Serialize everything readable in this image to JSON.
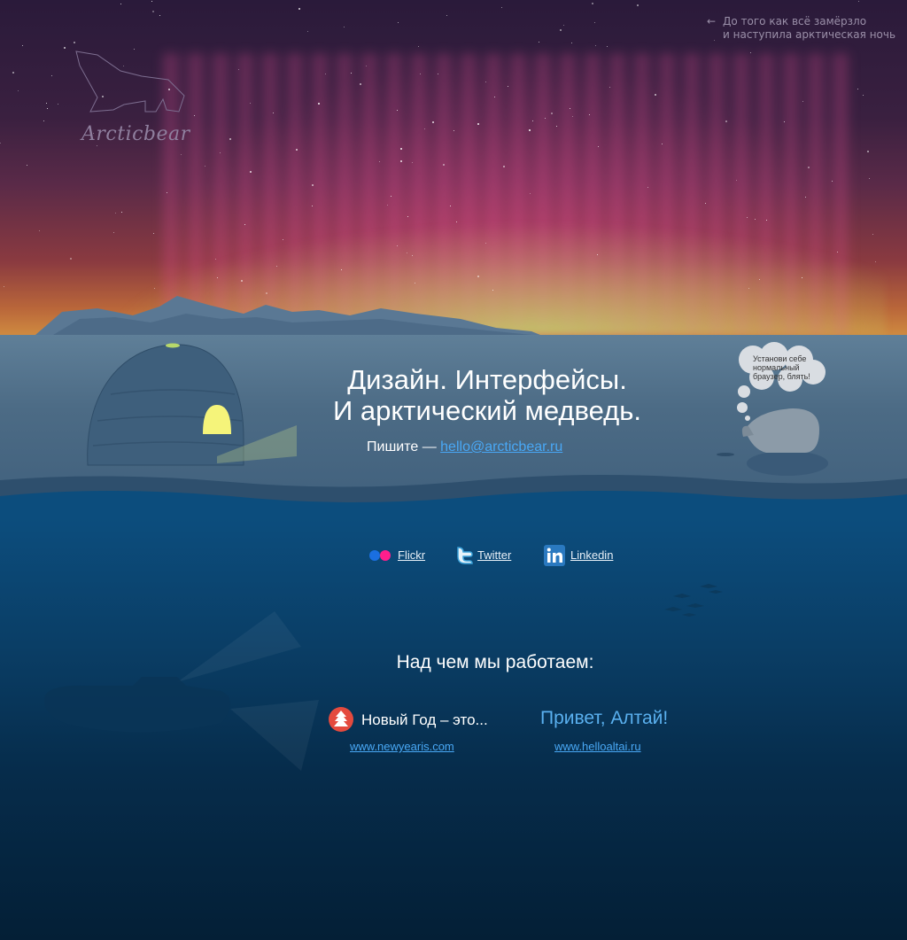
{
  "top_link": {
    "arrow": "←",
    "line1": "До того как всё замёрзло",
    "line2": "и наступила арктическая ночь"
  },
  "logo": {
    "text": "Arcticbear"
  },
  "headline": {
    "line1": "Дизайн. Интерфейсы.",
    "line2": "И арктический медведь."
  },
  "contact": {
    "prefix": "Пишите — ",
    "email": "hello@arcticbear.ru"
  },
  "bear_bubble": {
    "text": "Установи себе нормальный браузер, блять!"
  },
  "socials": [
    {
      "label": "Flickr",
      "icon": "flickr-icon"
    },
    {
      "label": "Twitter",
      "icon": "twitter-icon"
    },
    {
      "label": "Linkedin",
      "icon": "linkedin-icon"
    }
  ],
  "projects_section": {
    "title": "Над чем мы работаем:"
  },
  "projects": [
    {
      "title": "Новый Год – это...",
      "url": "www.newyearis.com",
      "icon": "tree-icon"
    },
    {
      "title": "Привет, Алтай!",
      "url": "www.helloaltai.ru"
    }
  ],
  "colors": {
    "link": "#49a8f5",
    "sea": "#0a3e66",
    "ice": "#4c6b85",
    "sky": "#3a2040"
  }
}
